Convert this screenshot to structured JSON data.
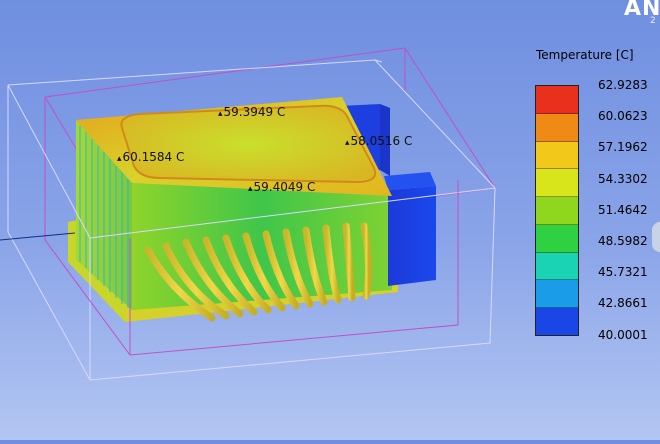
{
  "branding": {
    "text": "ANS",
    "sub": "2"
  },
  "legend": {
    "title": "Temperature [C]",
    "labels": [
      "62.9283",
      "60.0623",
      "57.1962",
      "54.3302",
      "51.4642",
      "48.5982",
      "45.7321",
      "42.8661",
      "40.0001"
    ],
    "band_colors": [
      "#e8301c",
      "#f08a16",
      "#f2c81a",
      "#d8e51a",
      "#8fd61e",
      "#2fd042",
      "#1ad2b4",
      "#1a9ce8",
      "#1a46e6"
    ]
  },
  "probes": [
    {
      "text": "59.3949 C"
    },
    {
      "text": "58.0516 C"
    },
    {
      "text": "60.1584 C"
    },
    {
      "text": "59.4049 C"
    }
  ]
}
